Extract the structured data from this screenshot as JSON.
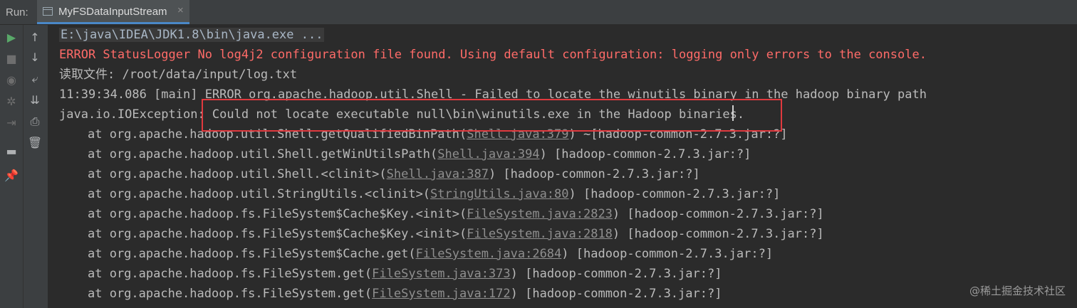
{
  "run_bar": {
    "label": "Run:",
    "tab_title": "MyFSDataInputStream",
    "tab_close": "×"
  },
  "toolbar": {
    "left": [
      {
        "name": "run-icon",
        "glyph": "▶",
        "color": "#59a869"
      },
      {
        "name": "stop-icon",
        "glyph": "■",
        "color": "#6e6e6e"
      },
      {
        "name": "camera-icon",
        "glyph": "◉",
        "color": "#6e6e6e"
      },
      {
        "name": "bug-icon",
        "glyph": "✲",
        "color": "#6e6e6e"
      },
      {
        "name": "exit-icon",
        "glyph": "⇥",
        "color": "#6e6e6e"
      },
      {
        "name": "layout-icon",
        "glyph": "▬",
        "color": "#afb1b3"
      },
      {
        "name": "pin-icon",
        "glyph": "📌",
        "color": "#afb1b3"
      }
    ],
    "right": [
      {
        "name": "up-arrow-icon",
        "glyph": "↑",
        "color": "#afb1b3"
      },
      {
        "name": "down-arrow-icon",
        "glyph": "↓",
        "color": "#afb1b3"
      },
      {
        "name": "soft-wrap-icon",
        "glyph": "⤶",
        "color": "#afb1b3"
      },
      {
        "name": "scroll-to-end-icon",
        "glyph": "⇊",
        "color": "#afb1b3"
      },
      {
        "name": "print-icon",
        "glyph": "⎙",
        "color": "#afb1b3"
      },
      {
        "name": "trash-icon",
        "glyph": "🗑",
        "color": "#afb1b3"
      }
    ]
  },
  "console": {
    "cmd": "E:\\java\\IDEA\\JDK1.8\\bin\\java.exe ...",
    "error_line": "ERROR StatusLogger No log4j2 configuration file found. Using default configuration: logging only errors to the console.",
    "read_line": "读取文件: /root/data/input/log.txt",
    "shell_error": "11:39:34.086 [main] ERROR org.apache.hadoop.util.Shell - Failed to locate the winutils binary in the hadoop binary path",
    "exception": "java.io.IOException: Could not locate executable null\\bin\\winutils.exe in the Hadoop binaries.",
    "stack": [
      {
        "pre": "at org.apache.hadoop.util.Shell.getQualifiedBinPath(",
        "link": "Shell.java:379",
        "post": ") ~[hadoop-common-2.7.3.jar:?]"
      },
      {
        "pre": "at org.apache.hadoop.util.Shell.getWinUtilsPath(",
        "link": "Shell.java:394",
        "post": ") [hadoop-common-2.7.3.jar:?]"
      },
      {
        "pre": "at org.apache.hadoop.util.Shell.<clinit>(",
        "link": "Shell.java:387",
        "post": ") [hadoop-common-2.7.3.jar:?]"
      },
      {
        "pre": "at org.apache.hadoop.util.StringUtils.<clinit>(",
        "link": "StringUtils.java:80",
        "post": ") [hadoop-common-2.7.3.jar:?]"
      },
      {
        "pre": "at org.apache.hadoop.fs.FileSystem$Cache$Key.<init>(",
        "link": "FileSystem.java:2823",
        "post": ") [hadoop-common-2.7.3.jar:?]"
      },
      {
        "pre": "at org.apache.hadoop.fs.FileSystem$Cache$Key.<init>(",
        "link": "FileSystem.java:2818",
        "post": ") [hadoop-common-2.7.3.jar:?]"
      },
      {
        "pre": "at org.apache.hadoop.fs.FileSystem$Cache.get(",
        "link": "FileSystem.java:2684",
        "post": ") [hadoop-common-2.7.3.jar:?]"
      },
      {
        "pre": "at org.apache.hadoop.fs.FileSystem.get(",
        "link": "FileSystem.java:373",
        "post": ") [hadoop-common-2.7.3.jar:?]"
      },
      {
        "pre": "at org.apache.hadoop.fs.FileSystem.get(",
        "link": "FileSystem.java:172",
        "post": ") [hadoop-common-2.7.3.jar:?]"
      }
    ]
  },
  "watermark": "@稀土掘金技术社区",
  "colors": {
    "error": "#ff6b68",
    "text": "#bbbbbb",
    "link": "#8f8f8f",
    "highlight_box": "#e0393e",
    "tab_accent": "#4a88c7"
  }
}
